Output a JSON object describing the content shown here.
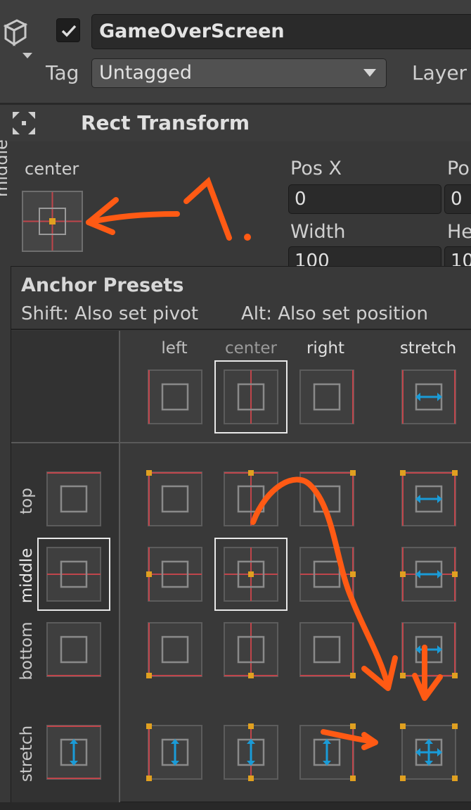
{
  "inspector": {
    "object_name": "GameOverScreen",
    "active": true,
    "tag_label": "Tag",
    "tag_value": "Untagged",
    "layer_label": "Layer",
    "icons": {
      "object": "cube-icon",
      "check": "checkmark-icon",
      "dropdown": "chevron-down-icon"
    }
  },
  "component": {
    "title": "Rect Transform",
    "icon": "rect-transform-icon",
    "anchor_label_h": "center",
    "anchor_label_v": "middle",
    "fields": {
      "pos_x_label": "Pos X",
      "pos_x_value": "0",
      "pos_y_label": "Po",
      "pos_y_value": "0",
      "width_label": "Width",
      "width_value": "100",
      "height_label": "He",
      "height_value": "10"
    }
  },
  "popup": {
    "title": "Anchor Presets",
    "hint_shift": "Shift: Also set pivot",
    "hint_alt": "Alt: Also set position",
    "columns": [
      "left",
      "center",
      "right",
      "stretch"
    ],
    "rows": [
      "top",
      "middle",
      "bottom",
      "stretch"
    ],
    "selected": {
      "column": "center",
      "row": "middle"
    }
  },
  "annotation": {
    "label": "1.",
    "color": "#ff5a14"
  },
  "colors": {
    "anchor_red": "#c0454b",
    "pivot_orange": "#e0a020",
    "stretch_blue": "#1a9bd7",
    "box_gray": "#8a8a8a"
  }
}
